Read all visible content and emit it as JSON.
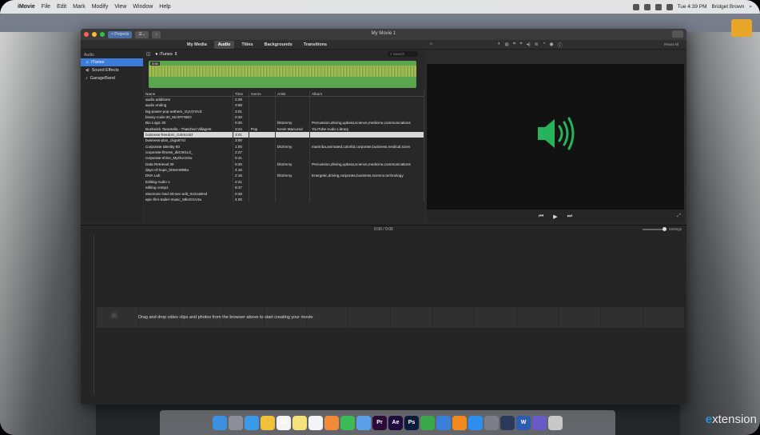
{
  "menubar": {
    "app": "iMovie",
    "items": [
      "File",
      "Edit",
      "Mark",
      "Modify",
      "View",
      "Window",
      "Help"
    ],
    "clock": "Tue 4:39 PM",
    "user": "Bridget Brown"
  },
  "window": {
    "title": "My Movie 1",
    "projects_label": "< Projects"
  },
  "tabs": [
    "My Media",
    "Audio",
    "Titles",
    "Backgrounds",
    "Transitions"
  ],
  "active_tab": "Audio",
  "reset_all": "Reset All",
  "sidebar": {
    "heading": "Audio",
    "items": [
      {
        "icon": "music-note-icon",
        "label": "iTunes",
        "selected": true
      },
      {
        "icon": "speaker-icon",
        "label": "Sound Effects",
        "selected": false
      },
      {
        "icon": "guitar-icon",
        "label": "GarageBand",
        "selected": false
      }
    ]
  },
  "browser": {
    "source": "iTunes",
    "search_placeholder": "Search",
    "waveform_duration": "3:55",
    "columns": [
      "Name",
      "Time",
      "Genre",
      "Artist",
      "Album"
    ],
    "rows": [
      [
        "audio additions",
        "2:29",
        "",
        "",
        ""
      ],
      [
        "audio ending",
        "3:58",
        "",
        "",
        ""
      ],
      [
        "big-power-pop-anthem_GyVjYSVd",
        "3:01",
        "",
        "",
        ""
      ],
      [
        "binary-code-30_McXFFSBO",
        "0:30",
        "",
        "",
        ""
      ],
      [
        "Bio Logic 30",
        "0:30",
        "",
        "bhzimmy",
        "Percussion,driving,upbeat,science,medicine,communications"
      ],
      [
        "Bushwick Tarantella - Thatched Villagers",
        "3:24",
        "Pop",
        "Kevin MacLeod",
        "YouTube Audio Library"
      ],
      [
        "business-freedom_G4tnUrdd",
        "3:01",
        "",
        "",
        ""
      ],
      [
        "business-plan_ckgo87rd",
        "3:00",
        "",
        "",
        ""
      ],
      [
        "Corporate Identity 60",
        "1:00",
        "",
        "bhzimmy",
        "marimba,animated,colorful,corporate,business,medical,scien"
      ],
      [
        "corporate-fitness_dkCW1LIl_",
        "2:27",
        "",
        "",
        ""
      ],
      [
        "corporate-shine_MyOUcSSu",
        "0:41",
        "",
        "",
        ""
      ],
      [
        "Data Retrieval 30",
        "0:30",
        "",
        "bhzimmy",
        "Percussion,driving,upbeat,science,medicine,communications"
      ],
      [
        "days-of-hope_bH5mW8Bu",
        "4:16",
        "",
        "",
        ""
      ],
      [
        "DNA Lab",
        "2:16",
        "",
        "bhzimmy",
        "Energetic,driving,corporate,business,science,technology"
      ],
      [
        "Editing Audio 1",
        "2:41",
        "",
        "",
        ""
      ],
      [
        "editing comp1",
        "8:37",
        "",
        "",
        ""
      ],
      [
        "electronic-bed-30-sec-edit_0c01oBHd",
        "0:28",
        "",
        "",
        ""
      ],
      [
        "epic-film-trailer-music_MkmOcV4u",
        "4:00",
        "",
        "",
        ""
      ]
    ],
    "selected_row": 6
  },
  "timeline": {
    "timecode": "0:00 / 0:00",
    "settings_label": "Settings",
    "drop_message": "Drag and drop video clips and photos from the browser above to start creating your movie."
  },
  "dock": {
    "icons": [
      "finder-icon",
      "launchpad-icon",
      "safari-icon",
      "notes-icon",
      "calendar-icon",
      "stickies-icon",
      "reminders-icon",
      "photos-icon",
      "facetime-icon",
      "preview-icon",
      "premiere-icon",
      "after-effects-icon",
      "photoshop-icon",
      "numbers-icon",
      "keynote-icon",
      "ibooks-icon",
      "app-store-icon",
      "system-preferences-icon",
      "quicktime-icon",
      "word-icon",
      "imovie-icon",
      "trash-icon"
    ],
    "labels": [
      "",
      "",
      "",
      "",
      "20",
      "",
      "",
      "",
      "",
      "",
      "Pr",
      "Ae",
      "Ps",
      "",
      "",
      "",
      "",
      "",
      "",
      "W",
      "",
      ""
    ]
  },
  "watermark": {
    "prefix": "e",
    "rest": "xtension"
  },
  "colors": {
    "selection": "#3b7bd9",
    "audio_green": "#5aa54e",
    "speaker_green": "#27b35a"
  }
}
